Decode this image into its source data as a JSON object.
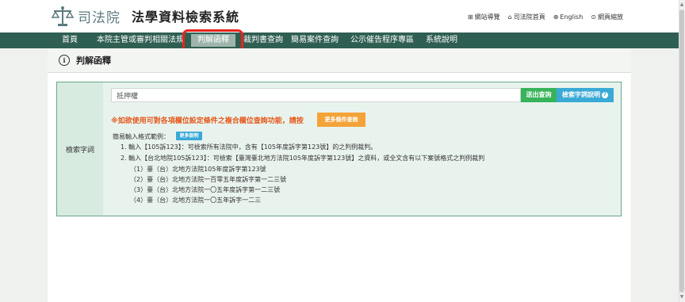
{
  "header": {
    "org_name": "司法院",
    "system_title": "法學資料檢索系統",
    "links": [
      {
        "icon": "sitemap-icon",
        "glyph": "⊞",
        "label": "網站導覽"
      },
      {
        "icon": "home-icon",
        "glyph": "⌂",
        "label": "司法院首頁"
      },
      {
        "icon": "globe-icon",
        "glyph": "⊕",
        "label": "English"
      },
      {
        "icon": "zoom-icon",
        "glyph": "⊙",
        "label": "網頁縮放"
      }
    ]
  },
  "nav": {
    "items": [
      "首頁",
      "本院主管或審判相關法規",
      "判解函釋",
      "裁判書查詢",
      "簡易案件查詢",
      "公示催告程序專區",
      "系統說明"
    ],
    "active": "判解函釋"
  },
  "page": {
    "title": "判解函釋"
  },
  "search": {
    "label": "檢索字詞",
    "value": "抵押權",
    "submit_label": "送出查詢",
    "help_label": "檢索字詞說明",
    "notice": "※如欲使用可對各項欄位設定條件之複合欄位查詢功能，請按",
    "more_conditions_label": "更多條件查詢",
    "example_heading": "簡易輸入格式範例：",
    "more_desc_label": "更多說明",
    "examples": [
      "1. 輸入【105訴123】：可檢索所有法院中，含有【105年度訴字第123號】的之判例裁判。",
      "2. 輸入【台北地院105訴123】：可檢索【臺灣臺北地方法院105年度訴字第123號】之資料，或全文含有以下案號格式之判例裁判",
      "（1）臺（台）北地方法院105年度訴字第123號",
      "（2）臺（台）北地方法院一百零五年度訴字第一二三號",
      "（3）臺（台）北地方法院一〇五年度訴字第一二三號",
      "（4）臺（台）北地方法院一〇五年訴字一二三"
    ]
  },
  "colors": {
    "navbar": "#2f5f52",
    "panel_border": "#6aa58c",
    "submit_button": "#37b35a",
    "help_button": "#3aa9d6",
    "more_conditions_button": "#f4a338",
    "notice_text": "#e5591b",
    "highlight": "#e8241c"
  }
}
